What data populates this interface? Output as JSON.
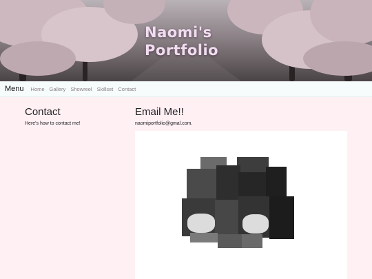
{
  "hero": {
    "title": "Naomi's\nPortfolio",
    "colors": {
      "title": "#f2ddf0",
      "blossom": "#d9c6cd"
    }
  },
  "navbar": {
    "brand": "Menu",
    "links": [
      "Home",
      "Gallery",
      "Showreel",
      "Skillset",
      "Contact"
    ]
  },
  "contact": {
    "heading": "Contact",
    "text": "Here's how to contact me!"
  },
  "email": {
    "heading": "Email Me!!",
    "address": "naomiportfolio@gmal.com."
  },
  "page": {
    "background": "#fff0f4"
  }
}
